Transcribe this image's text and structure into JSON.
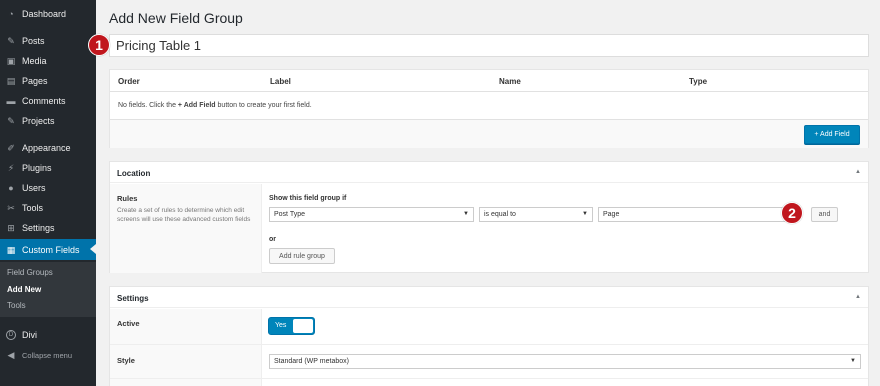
{
  "sidebar": {
    "items": [
      {
        "label": "Dashboard",
        "icon": "dashboard-icon"
      },
      {
        "label": "Posts",
        "icon": "pin-icon"
      },
      {
        "label": "Media",
        "icon": "media-icon"
      },
      {
        "label": "Pages",
        "icon": "pages-icon"
      },
      {
        "label": "Comments",
        "icon": "comments-icon"
      },
      {
        "label": "Projects",
        "icon": "pin-icon"
      },
      {
        "label": "Appearance",
        "icon": "brush-icon"
      },
      {
        "label": "Plugins",
        "icon": "plugin-icon"
      },
      {
        "label": "Users",
        "icon": "users-icon"
      },
      {
        "label": "Tools",
        "icon": "wrench-icon"
      },
      {
        "label": "Settings",
        "icon": "settings-icon"
      },
      {
        "label": "Custom Fields",
        "icon": "custom-fields-icon"
      }
    ],
    "submenu": [
      "Field Groups",
      "Add New",
      "Tools"
    ],
    "divi": "Divi",
    "collapse": "Collapse menu"
  },
  "page": {
    "title": "Add New Field Group",
    "group_title": "Pricing Table 1"
  },
  "badges": [
    "1",
    "2"
  ],
  "fields": {
    "columns": [
      "Order",
      "Label",
      "Name",
      "Type"
    ],
    "empty_pre": "No fields. Click the ",
    "empty_btn": "+ Add Field",
    "empty_post": " button to create your first field.",
    "add_button": "+ Add Field"
  },
  "location": {
    "title": "Location",
    "rules_label": "Rules",
    "rules_desc": "Create a set of rules to determine which edit screens will use these advanced custom fields",
    "show_if": "Show this field group if",
    "param": "Post Type",
    "operator": "is equal to",
    "value": "Page",
    "and_button": "and",
    "or_label": "or",
    "add_rule_group": "Add rule group"
  },
  "settings": {
    "title": "Settings",
    "active_label": "Active",
    "active_value": "Yes",
    "style_label": "Style",
    "style_value": "Standard (WP metabox)"
  },
  "colors": {
    "accent": "#0073aa",
    "badge": "#c0161d",
    "sidebar": "#23282d"
  }
}
